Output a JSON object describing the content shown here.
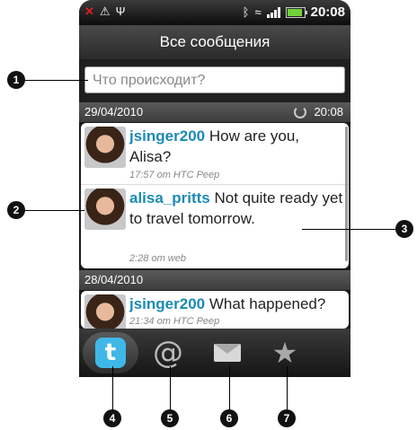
{
  "status": {
    "time": "20:08"
  },
  "header": {
    "title": "Все сообщения"
  },
  "compose": {
    "placeholder": "Что происходит?"
  },
  "groups": [
    {
      "date": "29/04/2010",
      "refresh_time": "20:08"
    },
    {
      "date": "28/04/2010"
    }
  ],
  "messages": [
    {
      "author": "jsinger200",
      "text": "How are you, Alisa?",
      "meta": "17:57 от HTC Peep"
    },
    {
      "author": "alisa_pritts",
      "text": "Not quite ready yet to travel tomorrow.",
      "meta": "2:28 от web"
    },
    {
      "author": "jsinger200",
      "text": "What happened?",
      "meta": "21:34 от HTC Peep"
    }
  ],
  "tabs": [
    {
      "icon": "twitter-icon",
      "glyph": "t"
    },
    {
      "icon": "mentions-icon",
      "glyph": "@"
    },
    {
      "icon": "messages-icon"
    },
    {
      "icon": "favorites-icon",
      "glyph": "★"
    }
  ],
  "callouts": [
    "1",
    "2",
    "3",
    "4",
    "5",
    "6",
    "7"
  ]
}
